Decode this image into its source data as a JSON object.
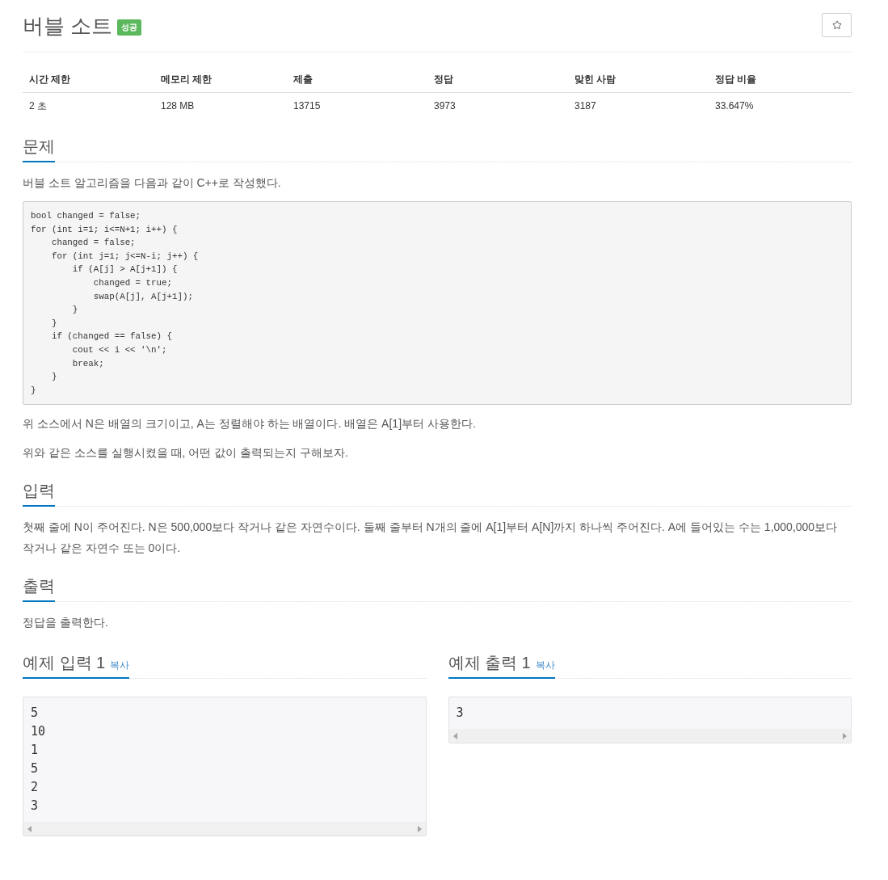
{
  "problem": {
    "title": "버블 소트",
    "badge": "성공"
  },
  "info_table": {
    "columns": [
      "시간 제한",
      "메모리 제한",
      "제출",
      "정답",
      "맞힌 사람",
      "정답 비율"
    ],
    "rows": [
      [
        "2 초",
        "128 MB",
        "13715",
        "3973",
        "3187",
        "33.647%"
      ]
    ]
  },
  "sections": [
    {
      "heading": "문제",
      "blocks": [
        {
          "kind": "text",
          "text": "버블 소트 알고리즘을 다음과 같이 C++로 작성했다."
        },
        {
          "kind": "code",
          "lines": [
            "bool changed = false;",
            "for (int i=1; i<=N+1; i++) {",
            "    changed = false;",
            "    for (int j=1; j<=N-i; j++) {",
            "        if (A[j] > A[j+1]) {",
            "            changed = true;",
            "            swap(A[j], A[j+1]);",
            "        }",
            "    }",
            "    if (changed == false) {",
            "        cout << i << '\\n';",
            "        break;",
            "    }",
            "}"
          ]
        },
        {
          "kind": "text",
          "text": "위 소스에서 N은 배열의 크기이고, A는 정렬해야 하는 배열이다. 배열은 A[1]부터 사용한다."
        },
        {
          "kind": "text",
          "text": "위와 같은 소스를 실행시켰을 때, 어떤 값이 출력되는지 구해보자."
        }
      ]
    },
    {
      "heading": "입력",
      "blocks": [
        {
          "kind": "text",
          "text": "첫째 줄에 N이 주어진다. N은 500,000보다 작거나 같은 자연수이다. 둘째 줄부터 N개의 줄에 A[1]부터 A[N]까지 하나씩 주어진다. A에 들어있는 수는 1,000,000보다 작거나 같은 자연수 또는 0이다."
        }
      ]
    },
    {
      "heading": "출력",
      "blocks": [
        {
          "kind": "text",
          "text": "정답을 출력한다."
        }
      ]
    }
  ],
  "samples": [
    {
      "title": "예제 입력 1",
      "copy": "복사",
      "lines": [
        "5",
        "10",
        "1",
        "5",
        "2",
        "3"
      ]
    },
    {
      "title": "예제 출력 1",
      "copy": "복사",
      "lines": [
        "3"
      ]
    }
  ]
}
